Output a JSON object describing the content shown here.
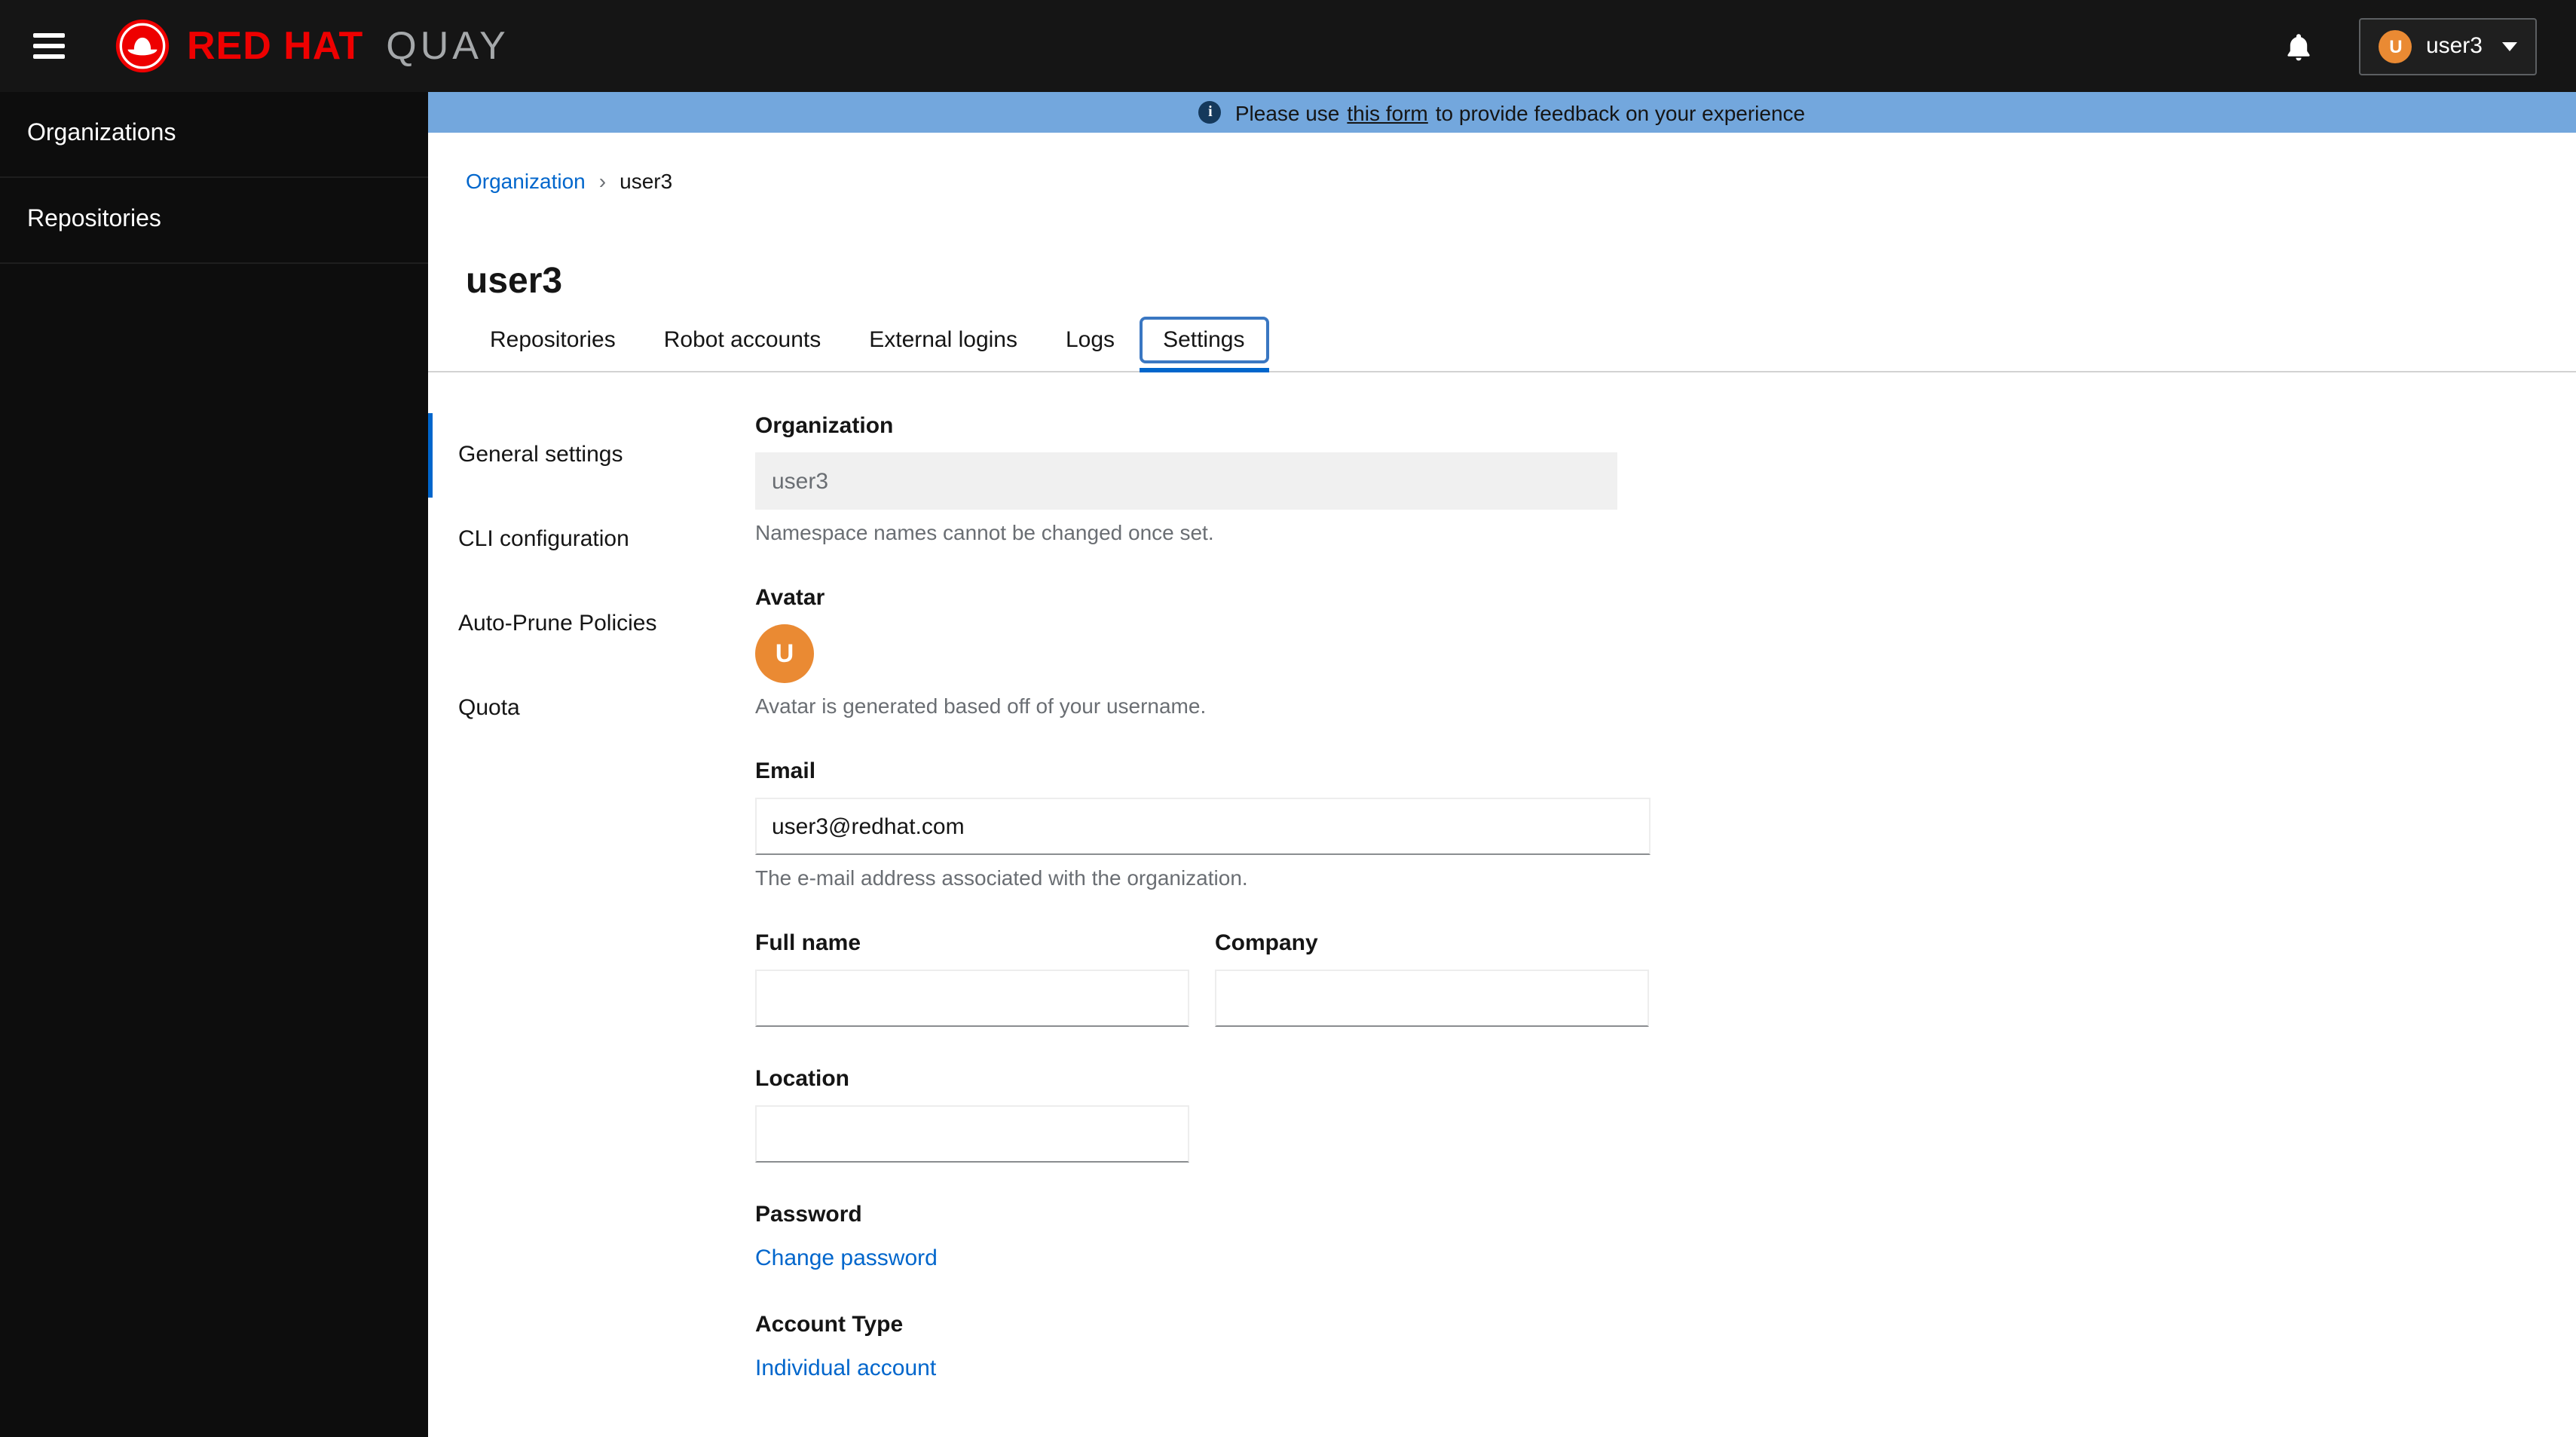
{
  "colors": {
    "accent": "#0066cc",
    "brand_red": "#ee0000",
    "banner_background": "#73a7dd",
    "avatar_orange": "#ea8a33",
    "masthead_background": "#151515"
  },
  "icons": {
    "menu": "hamburger-icon",
    "brand": "red-hat-logo-icon",
    "notifications": "bell-icon",
    "user_dropdown": "chevron-down-icon",
    "banner": "info-circle-icon",
    "breadcrumb_separator": "angle-right-icon"
  },
  "header": {
    "brand_red_hat": "RED HAT",
    "brand_quay": "QUAY",
    "user": {
      "name": "user3",
      "avatar_initial": "U"
    }
  },
  "sidebar": {
    "items": [
      {
        "label": "Organizations"
      },
      {
        "label": "Repositories"
      }
    ]
  },
  "banner": {
    "prefix": "Please use",
    "link_text": "this form",
    "suffix": "to provide feedback on your experience",
    "info_glyph": "i"
  },
  "breadcrumb": {
    "root": "Organization",
    "separator": "›",
    "current": "user3"
  },
  "page_title": "user3",
  "tabs": {
    "active": "Settings",
    "items": [
      {
        "label": "Repositories"
      },
      {
        "label": "Robot accounts"
      },
      {
        "label": "External logins"
      },
      {
        "label": "Logs"
      },
      {
        "label": "Settings"
      }
    ]
  },
  "settings_nav": {
    "active": "General settings",
    "items": [
      {
        "label": "General settings"
      },
      {
        "label": "CLI configuration"
      },
      {
        "label": "Auto-Prune Policies"
      },
      {
        "label": "Quota"
      }
    ]
  },
  "form": {
    "organization": {
      "label": "Organization",
      "value": "user3",
      "helper": "Namespace names cannot be changed once set."
    },
    "avatar": {
      "label": "Avatar",
      "initial": "U",
      "helper": "Avatar is generated based off of your username."
    },
    "email": {
      "label": "Email",
      "value": "user3@redhat.com",
      "helper": "The e-mail address associated with the organization."
    },
    "full_name": {
      "label": "Full name",
      "value": ""
    },
    "company": {
      "label": "Company",
      "value": ""
    },
    "location": {
      "label": "Location",
      "value": ""
    },
    "password": {
      "label": "Password",
      "action": "Change password"
    },
    "account_type": {
      "label": "Account Type",
      "action": "Individual account"
    }
  }
}
